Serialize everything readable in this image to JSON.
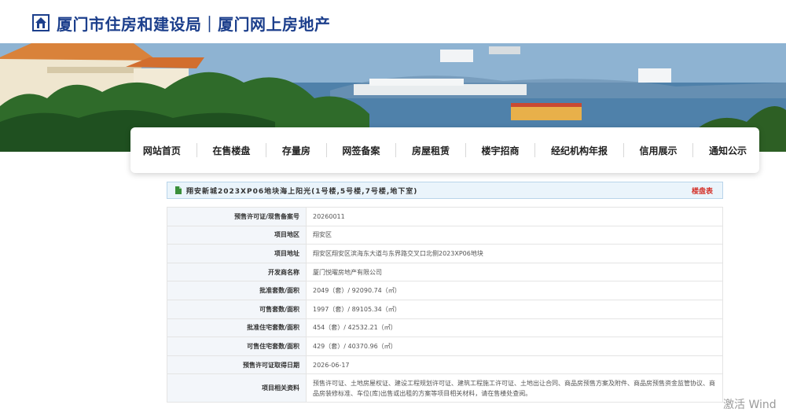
{
  "header": {
    "site_title": "厦门市住房和建设局｜厦门网上房地产",
    "logo_icon": "house-icon"
  },
  "nav": {
    "items": [
      {
        "label": "网站首页"
      },
      {
        "label": "在售楼盘"
      },
      {
        "label": "存量房"
      },
      {
        "label": "网签备案"
      },
      {
        "label": "房屋租赁"
      },
      {
        "label": "楼宇招商"
      },
      {
        "label": "经纪机构年报"
      },
      {
        "label": "信用展示"
      },
      {
        "label": "通知公示"
      }
    ]
  },
  "project": {
    "title": "翔安新城2023XP06地块海上阳光(1号楼,5号楼,7号楼,地下室)",
    "table_link": "楼盘表",
    "rows": [
      {
        "label": "预售许可证/现售备案号",
        "value": "20260011"
      },
      {
        "label": "项目地区",
        "value": "翔安区"
      },
      {
        "label": "项目地址",
        "value": "翔安区翔安区滨海东大道与东界路交叉口北侧2023XP06地块"
      },
      {
        "label": "开发商名称",
        "value": "厦门悦曜房地产有限公司"
      },
      {
        "label": "批准套数/面积",
        "value": "2049（套）/ 92090.74（㎡）"
      },
      {
        "label": "可售套数/面积",
        "value": "1997（套）/ 89105.34（㎡）"
      },
      {
        "label": "批准住宅套数/面积",
        "value": "454（套）/ 42532.21（㎡）"
      },
      {
        "label": "可售住宅套数/面积",
        "value": "429（套）/ 40370.96（㎡）"
      },
      {
        "label": "预售许可证取得日期",
        "value": "2026-06-17"
      },
      {
        "label": "项目相关资料",
        "value": "预售许可证、土地房屋权证、建设工程规划许可证、建筑工程施工许可证、土地出让合同、商品房预售方案及附件、商品房预售资金监管协议、商品房装修标准、车位(库)出售或出租的方案等项目相关材料，请在售楼处查阅。"
      }
    ]
  },
  "watermark": {
    "text": "激活 Wind"
  },
  "colors": {
    "brand_blue": "#1c3f8c",
    "link_red": "#d4322a",
    "titlebar_bg": "#eaf4fb"
  }
}
